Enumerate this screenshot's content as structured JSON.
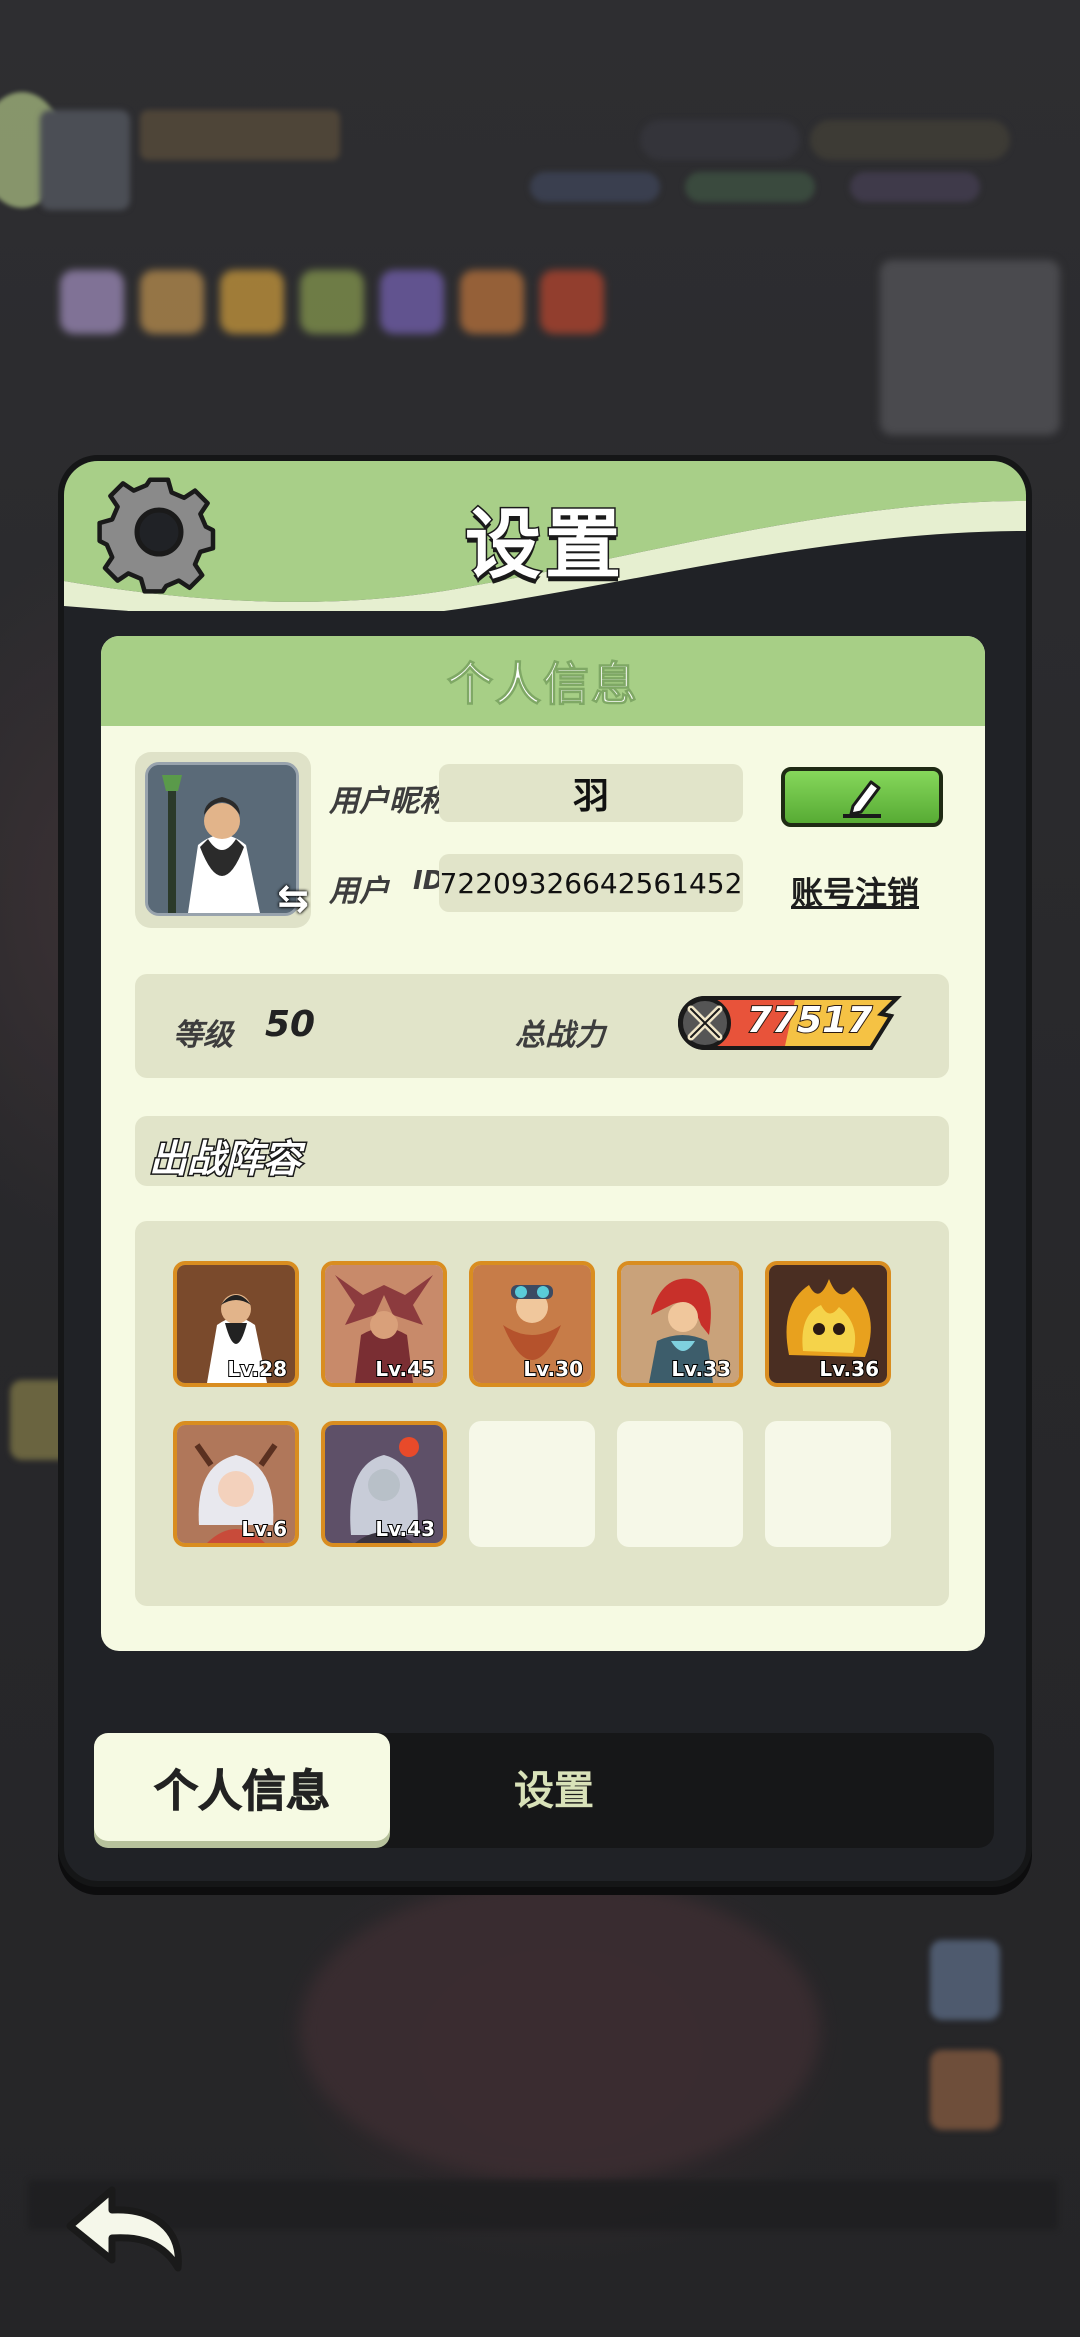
{
  "panel": {
    "title": "设置"
  },
  "profile": {
    "section_title": "个人信息",
    "nickname_label": "用户昵称",
    "nickname": "羽",
    "id_label": "用户",
    "id_suffix": "ID",
    "user_id": "72209326642561452",
    "logout_label": "账号注销",
    "level_label": "等级",
    "level": "50",
    "power_label": "总战力",
    "power": "77517"
  },
  "lineup": {
    "title": "出战阵容",
    "heroes": [
      {
        "level": "Lv.28",
        "color": "#7a4a2c"
      },
      {
        "level": "Lv.45",
        "color": "#8c3b3e"
      },
      {
        "level": "Lv.30",
        "color": "#b5522c"
      },
      {
        "level": "Lv.33",
        "color": "#3d5d6b"
      },
      {
        "level": "Lv.36",
        "color": "#c8721e"
      },
      {
        "level": "Lv.6",
        "color": "#b0775a"
      },
      {
        "level": "Lv.43",
        "color": "#5e5068"
      }
    ],
    "empty_slots": 3
  },
  "tabs": {
    "profile": "个人信息",
    "settings": "设置"
  },
  "colors": {
    "accent_green": "#a7cf86",
    "card_bg": "#f6fae3",
    "field_bg": "#e1e4c9",
    "hero_border": "#d98d20"
  }
}
